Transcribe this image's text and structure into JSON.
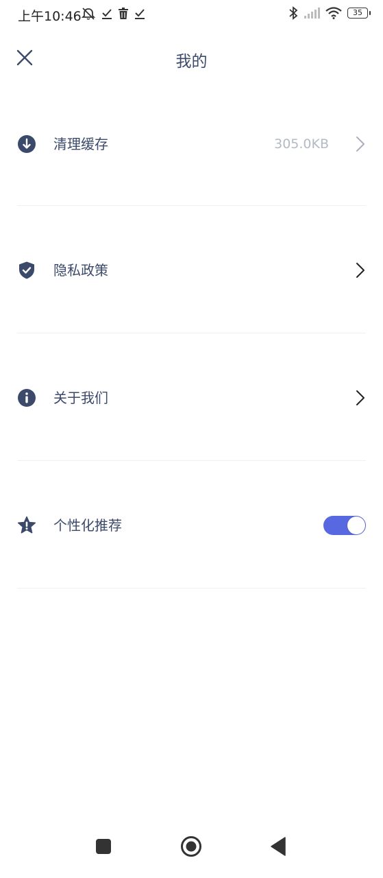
{
  "status_bar": {
    "time": "上午10:46",
    "battery": "35"
  },
  "header": {
    "title": "我的"
  },
  "settings": {
    "items": [
      {
        "label": "清理缓存",
        "value": "305.0KB"
      },
      {
        "label": "隐私政策"
      },
      {
        "label": "关于我们"
      },
      {
        "label": "个性化推荐",
        "toggle_on": true
      }
    ]
  },
  "colors": {
    "text": "#3b4a6b",
    "value_text": "#b4bac5",
    "toggle_on": "#5868e0",
    "divider": "#eef0f3"
  },
  "icons": {
    "close": "close-icon",
    "clear_cache": "download-circle-icon",
    "privacy": "shield-check-icon",
    "about": "info-circle-icon",
    "personalized": "star-alert-icon"
  }
}
